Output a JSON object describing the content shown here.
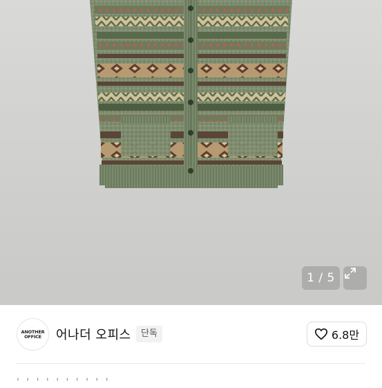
{
  "image": {
    "alt": "",
    "counter": "1 / 5",
    "icon": "expand-icon"
  },
  "brand": {
    "logo_line1": "ANOTHER",
    "logo_line2": "OFFICE",
    "name": "어나더 오피스",
    "badge": "단독"
  },
  "like": {
    "icon": "heart-outline-icon",
    "count": "6.8만"
  },
  "partial_text": "' ' ' ' ' ' ' ' ' '"
}
